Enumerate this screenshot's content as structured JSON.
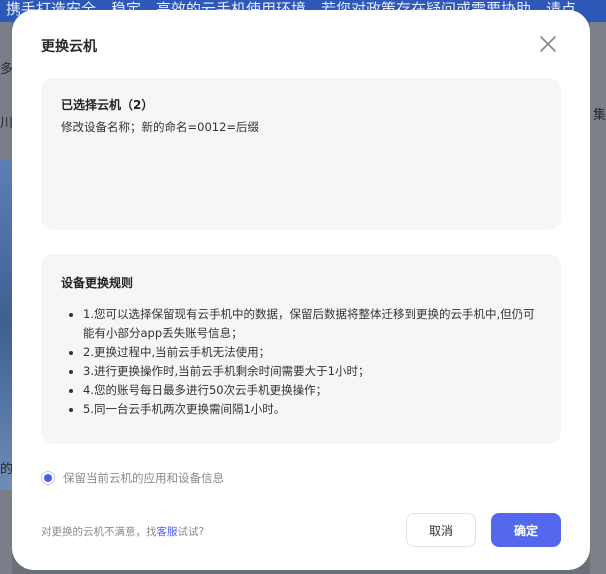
{
  "background": {
    "banner_text": "携手打造安全，稳定，高效的云手机使用环境，若您对政策存在疑问或需要协助，请点",
    "left_frag_1": "多",
    "left_frag_2": "川",
    "left_frag_3": "的",
    "right_frag": "集"
  },
  "modal": {
    "title": "更换云机",
    "selected": {
      "title": "已选择云机（2）",
      "description": "修改设备名称；新的命名=0012=后缀"
    },
    "rules": {
      "title": "设备更换规则",
      "items": [
        "1.您可以选择保留现有云手机中的数据，保留后数据将整体迁移到更换的云手机中,但仍可能有小部分app丢失账号信息；",
        "2.更换过程中,当前云手机无法使用；",
        "3.进行更换操作时,当前云手机剩余时间需要大于1小时；",
        "4.您的账号每日最多进行50次云手机更换操作；",
        "5.同一台云手机两次更换需间隔1小时。"
      ]
    },
    "radio_label": "保留当前云机的应用和设备信息",
    "radio_checked": true,
    "footer": {
      "note_prefix": "对更换的云机不满意，找",
      "note_link": "客服",
      "note_suffix": "试试?"
    },
    "buttons": {
      "cancel": "取消",
      "confirm": "确定"
    }
  },
  "colors": {
    "accent": "#5468ee",
    "overlay": "#6b6f78"
  }
}
